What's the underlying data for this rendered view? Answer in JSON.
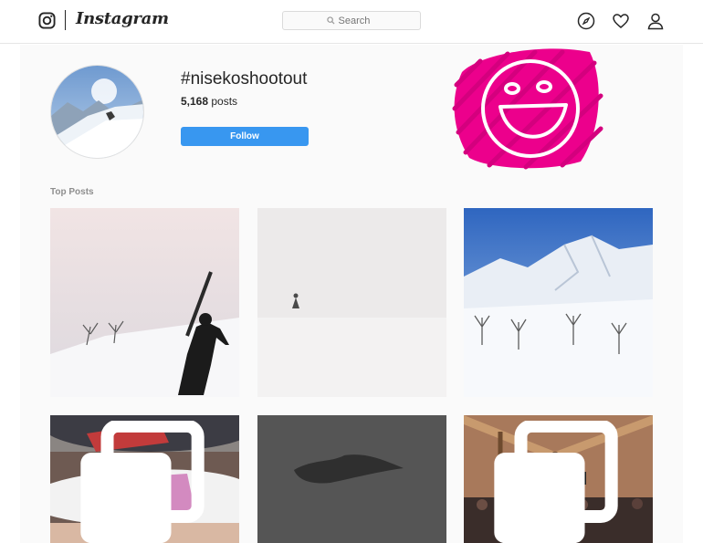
{
  "header": {
    "wordmark": "Instagram",
    "search_placeholder": "Search",
    "icons": [
      "instagram-icon",
      "compass-icon",
      "heart-icon",
      "profile-icon"
    ]
  },
  "tag": {
    "title": "#nisekoshootout",
    "post_count": "5,168",
    "post_suffix": " posts",
    "follow_label": "Follow"
  },
  "top_posts": {
    "label": "Top Posts",
    "posts": [
      {
        "subject": "skier-carrying-skis"
      },
      {
        "subject": "skier-in-whiteout"
      },
      {
        "subject": "snowy-mountains"
      },
      {
        "subject": "goggles-closeup",
        "multiple": true
      },
      {
        "subject": "dark-landscape"
      },
      {
        "subject": "lodge-crowd",
        "multiple": true
      }
    ]
  },
  "colors": {
    "accent": "#3897f0",
    "smiley": "#ec008c"
  }
}
